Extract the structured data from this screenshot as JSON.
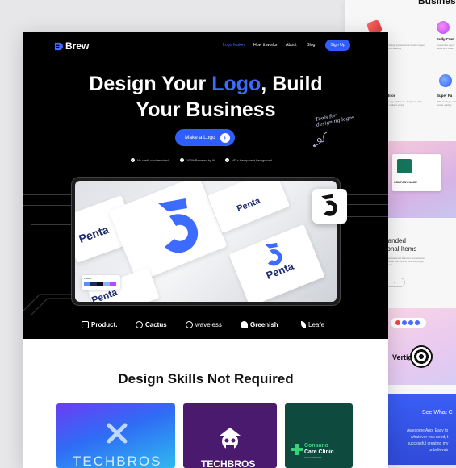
{
  "background_page": {
    "title": "Busines",
    "features": [
      {
        "title": "Fully Cust",
        "icon": "paint-palette-icon"
      },
      {
        "title": "Super Fa",
        "icon": "lightning-icon"
      },
      {
        "title": "e",
        "icon": "brush-icon"
      },
      {
        "title": "ndly Editor",
        "icon": "editor-icon"
      }
    ],
    "branded_heading_1": "randed",
    "branded_heading_2": "otional Items",
    "btn_label": ">",
    "mock_text": "COMPANY NAME",
    "vertigo_text": "Vertig",
    "blue_section_title": "See What C",
    "blue_section_text_1": "Awesome App! Easy to",
    "blue_section_text_2": "whatever you need, t",
    "blue_section_text_3": "successful creating my",
    "blue_section_text_4": "unbelievab"
  },
  "header": {
    "logo_text": "Brew",
    "nav": [
      "Logo Maker",
      "How it works",
      "About",
      "Blog"
    ],
    "signup_label": "Sign Up"
  },
  "hero": {
    "title_part1": "Design Your ",
    "title_accent": "Logo",
    "title_part2": ", Build",
    "title_line2": "Your Business",
    "cta_label": "Make a Logo",
    "hand_note_1": "Tools for",
    "hand_note_2": "designing logos",
    "features": [
      "No credit card required",
      "100% Powered by AI",
      "HD + transparent background"
    ]
  },
  "showcase": {
    "brand_word": "Penta",
    "palette_label": "Palette",
    "colors": [
      "#5a8dff",
      "#1e2a5c",
      "#0b0b1a",
      "#8ab0ff",
      "#b54cff"
    ]
  },
  "brands": [
    "Product.",
    "Cactus",
    "waveless",
    "Greenish",
    "Leafe"
  ],
  "skills": {
    "title": "Design Skills Not Required",
    "tiles": [
      {
        "name": "TECHBROS",
        "bg": "#2f6cf5"
      },
      {
        "name": "TECHBROS",
        "bg": "#4a1a6e"
      },
      {
        "name": "Consano",
        "sub": "Care Clinic",
        "tag": "FAMILY MEDICINE",
        "bg": "#0e4a3e"
      }
    ]
  },
  "colors": {
    "accent": "#2f5dff",
    "hero_bg": "#000000"
  }
}
